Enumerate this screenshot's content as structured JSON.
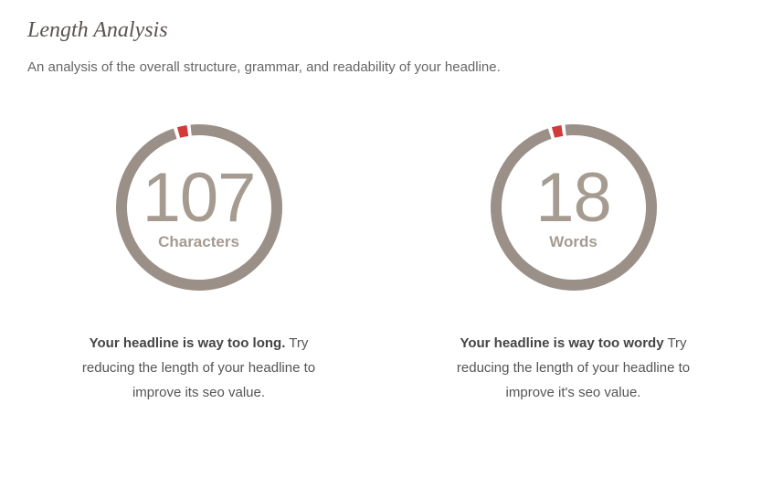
{
  "section": {
    "title": "Length Analysis",
    "description": "An analysis of the overall structure, grammar, and readability of your headline."
  },
  "colors": {
    "ring": "#9b9087",
    "accent": "#d33a3a",
    "value": "#a59b90"
  },
  "gauges": [
    {
      "value": "107",
      "label": "Characters",
      "feedback_bold": "Your headline is way too long.",
      "feedback_rest": " Try reducing the length of your headline to improve its seo value."
    },
    {
      "value": "18",
      "label": "Words",
      "feedback_bold": "Your headline is way too wordy",
      "feedback_rest": " Try reducing the length of your headline to improve it's seo value."
    }
  ]
}
